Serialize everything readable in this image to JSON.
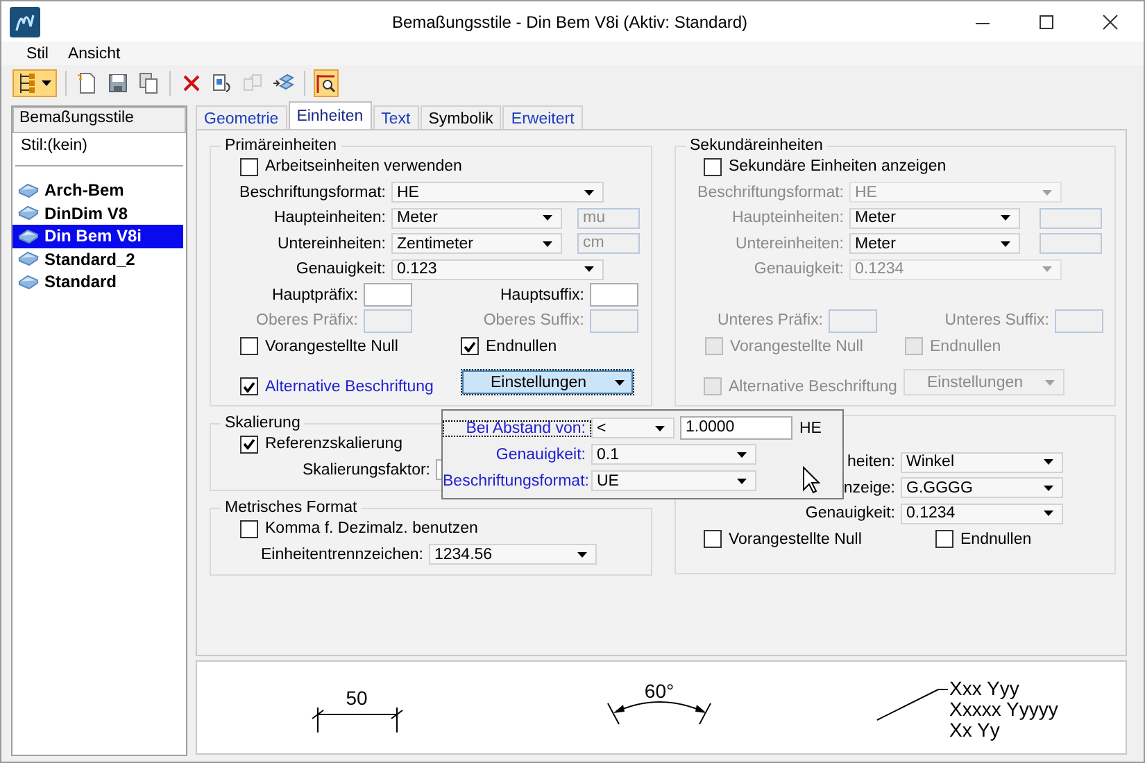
{
  "window": {
    "title": "Bemaßungsstile - Din Bem V8i (Aktiv: Standard)"
  },
  "menu": [
    {
      "label": "Stil"
    },
    {
      "label": "Ansicht"
    }
  ],
  "toolbar": {
    "groups": [
      {
        "buttons": [
          {
            "on": true,
            "disabled": false,
            "has_menu": true
          }
        ]
      },
      {
        "buttons": [
          {
            "on": false,
            "disabled": false,
            "has_menu": false
          },
          {
            "on": false,
            "disabled": false,
            "has_menu": false
          },
          {
            "on": false,
            "disabled": false,
            "has_menu": false
          }
        ]
      },
      {
        "buttons": [
          {
            "on": false,
            "disabled": false,
            "has_menu": false
          },
          {
            "on": false,
            "disabled": false,
            "has_menu": false
          },
          {
            "on": false,
            "disabled": true,
            "has_menu": false
          },
          {
            "on": false,
            "disabled": false,
            "has_menu": false
          }
        ]
      },
      {
        "buttons": [
          {
            "on": true,
            "disabled": false,
            "has_menu": false
          }
        ]
      }
    ]
  },
  "sidebar": {
    "header": "Bemaßungsstile",
    "current": "Stil:(kein)",
    "items": [
      {
        "label": "Arch-Bem",
        "selected": false
      },
      {
        "label": "DinDim V8",
        "selected": false
      },
      {
        "label": "Din Bem V8i",
        "selected": true
      },
      {
        "label": "Standard_2",
        "selected": false
      },
      {
        "label": "Standard",
        "selected": false
      }
    ]
  },
  "tabs": [
    {
      "label": "Geometrie",
      "selected": false,
      "modified": true
    },
    {
      "label": "Einheiten",
      "selected": true,
      "modified": true
    },
    {
      "label": "Text",
      "selected": false,
      "modified": true
    },
    {
      "label": "Symbolik",
      "selected": false,
      "modified": false
    },
    {
      "label": "Erweitert",
      "selected": false,
      "modified": true
    }
  ],
  "primary": {
    "title": "Primäreinheiten",
    "rows": [
      {
        "kind": "checkbox",
        "label": "Arbeitseinheiten verwenden",
        "checked": false,
        "disabled": false
      },
      {
        "kind": "select",
        "label": "Beschriftungsformat:",
        "value": "HE",
        "label_disabled": false,
        "disabled": false
      },
      {
        "kind": "select",
        "label": "Haupteinheiten:",
        "value": "Meter",
        "label_disabled": false,
        "disabled": false,
        "suffix": {
          "value": "mu",
          "disabled": true
        }
      },
      {
        "kind": "select",
        "label": "Untereinheiten:",
        "value": "Zentimeter",
        "label_disabled": false,
        "disabled": false,
        "suffix": {
          "value": "cm",
          "disabled": true
        }
      },
      {
        "kind": "select",
        "label": "Genauigkeit:",
        "value": "0.123",
        "label_disabled": false,
        "disabled": false
      },
      {
        "kind": "pair",
        "items": [
          {
            "label": "Hauptpräfix:",
            "disabled": false
          },
          {
            "label": "Hauptsuffix:",
            "disabled": false
          }
        ]
      },
      {
        "kind": "pair",
        "items": [
          {
            "label": "Oberes Präfix:",
            "disabled": true
          },
          {
            "label": "Oberes Suffix:",
            "disabled": true
          }
        ]
      },
      {
        "kind": "checks",
        "items": [
          {
            "label": "Vorangestellte Null",
            "checked": false,
            "disabled": false
          },
          {
            "label": "Endnullen",
            "checked": true,
            "disabled": false
          }
        ]
      },
      {
        "kind": "alt",
        "label": "Alternative Beschriftung",
        "checked": true,
        "disabled": false,
        "modified": true,
        "button": "Einstellungen",
        "focused": true
      }
    ]
  },
  "secondary": {
    "title": "Sekundäreinheiten",
    "rows": [
      {
        "kind": "checkbox",
        "label": "Sekundäre Einheiten anzeigen",
        "checked": false,
        "disabled": false
      },
      {
        "kind": "select",
        "label": "Beschriftungsformat:",
        "value": "HE",
        "label_disabled": true,
        "disabled": true
      },
      {
        "kind": "select",
        "label": "Haupteinheiten:",
        "value": "Meter",
        "label_disabled": true,
        "disabled": false,
        "suffix": {
          "disabled": true
        }
      },
      {
        "kind": "select",
        "label": "Untereinheiten:",
        "value": "Meter",
        "label_disabled": true,
        "disabled": false,
        "suffix": {
          "disabled": true
        }
      },
      {
        "kind": "select",
        "label": "Genauigkeit:",
        "value": "0.1234",
        "label_disabled": true,
        "disabled": true
      },
      {
        "kind": "spacer"
      },
      {
        "kind": "pair",
        "items": [
          {
            "label": "Unteres Präfix:",
            "disabled": true
          },
          {
            "label": "Unteres Suffix:",
            "disabled": true
          }
        ]
      },
      {
        "kind": "checks",
        "items": [
          {
            "label": "Vorangestellte Null",
            "checked": false,
            "disabled": true
          },
          {
            "label": "Endnullen",
            "checked": false,
            "disabled": true
          }
        ]
      },
      {
        "kind": "alt",
        "label": "Alternative Beschriftung",
        "checked": false,
        "disabled": true,
        "button": "Einstellungen",
        "focused": false
      }
    ]
  },
  "scaling": {
    "title": "Skalierung",
    "rows": [
      {
        "kind": "checkbox",
        "label": "Referenzskalierung",
        "checked": true,
        "disabled": false
      },
      {
        "kind": "field",
        "label": "Skalierungsfaktor:"
      }
    ]
  },
  "metric": {
    "title": "Metrisches Format",
    "rows": [
      {
        "kind": "checkbox",
        "label": "Komma f. Dezimalz. benutzen",
        "checked": false,
        "disabled": false
      },
      {
        "kind": "select",
        "label": "Einheitentrennzeichen:",
        "value": "1234.56",
        "label_disabled": false,
        "disabled": false
      }
    ]
  },
  "angle": {
    "rows": [
      {
        "kind": "select",
        "label": "heiten:",
        "value": "Winkel",
        "label_disabled": false,
        "disabled": false
      },
      {
        "kind": "select",
        "label": "nzeige:",
        "value": "G.GGGG",
        "label_disabled": false,
        "disabled": false
      },
      {
        "kind": "select",
        "label": "Genauigkeit:",
        "value": "0.1234",
        "label_disabled": false,
        "disabled": false
      },
      {
        "kind": "checks",
        "items": [
          {
            "label": "Vorangestellte Null",
            "checked": false,
            "disabled": false
          },
          {
            "label": "Endnullen",
            "checked": false,
            "disabled": false
          }
        ]
      }
    ]
  },
  "popup": {
    "rows": [
      {
        "kind": "compare",
        "label": "Bei Abstand von:",
        "value": "<",
        "input": "1.0000",
        "unit": "HE",
        "focused": true
      },
      {
        "kind": "select",
        "label": "Genauigkeit:",
        "value": "0.1",
        "label_disabled": false,
        "disabled": false,
        "modified": true
      },
      {
        "kind": "select",
        "label": "Beschriftungsformat:",
        "value": "UE",
        "label_disabled": false,
        "disabled": false,
        "modified": true
      }
    ]
  },
  "preview": {
    "length": "50",
    "angle": "60°",
    "leader_lines": [
      "Xxx Yyy",
      "Xxxxx Yyyyy",
      "Xx Yy"
    ]
  }
}
